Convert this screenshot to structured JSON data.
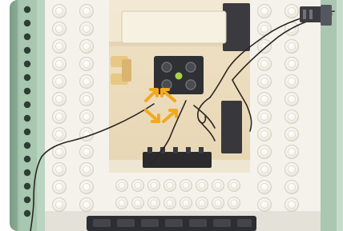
{
  "image": {
    "kind": "photo",
    "subject": "lego-technic-hub-with-wires",
    "overlay_icon": "expand-arrows-icon",
    "accent": "#f2a91c",
    "studs_color": "#f5f3ec",
    "frame_color": "#a9c7b1"
  }
}
